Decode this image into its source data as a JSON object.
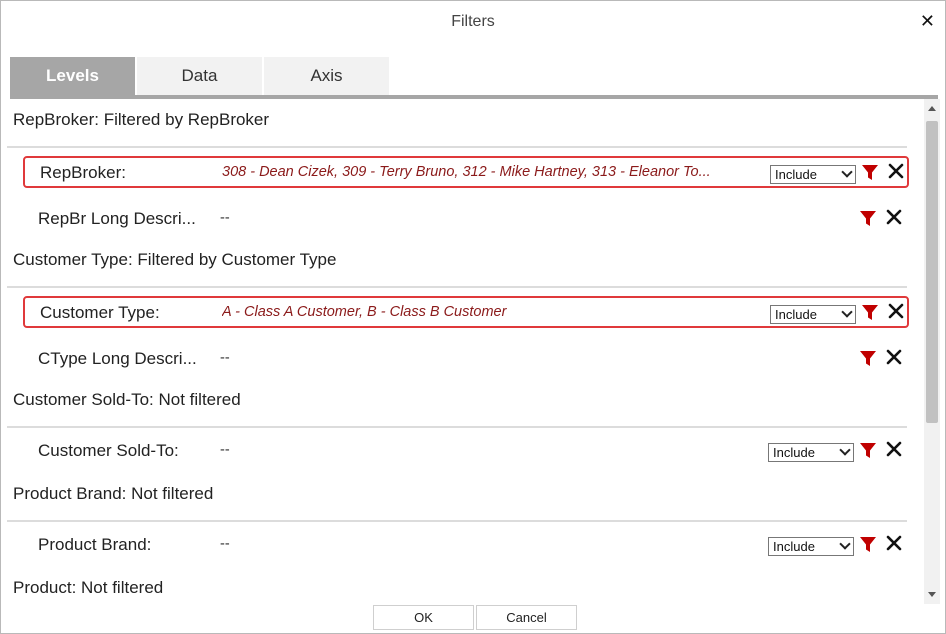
{
  "dialog": {
    "title": "Filters"
  },
  "tabs": [
    {
      "label": "Levels",
      "active": true
    },
    {
      "label": "Data",
      "active": false
    },
    {
      "label": "Axis",
      "active": false
    }
  ],
  "groups": [
    {
      "header": "RepBroker: Filtered by RepBroker",
      "rows": [
        {
          "label": "RepBroker:",
          "value": "308 - Dean Cizek, 309 - Terry Bruno, 312 - Mike Hartney, 313 - Eleanor To...",
          "select": "Include",
          "highlight": true
        },
        {
          "label": "RepBr Long Descri...",
          "value": "--",
          "select": "",
          "highlight": false
        }
      ]
    },
    {
      "header": "Customer Type: Filtered by Customer Type",
      "rows": [
        {
          "label": "Customer Type:",
          "value": "A - Class A Customer, B - Class B Customer",
          "select": "Include",
          "highlight": true
        },
        {
          "label": "CType Long Descri...",
          "value": "--",
          "select": "",
          "highlight": false
        }
      ]
    },
    {
      "header": "Customer Sold-To: Not filtered",
      "rows": [
        {
          "label": "Customer Sold-To:",
          "value": "--",
          "select": "Include",
          "highlight": false
        }
      ]
    },
    {
      "header": "Product Brand: Not filtered",
      "rows": [
        {
          "label": "Product Brand:",
          "value": "--",
          "select": "Include",
          "highlight": false
        }
      ]
    },
    {
      "header": "Product: Not filtered",
      "rows": []
    }
  ],
  "buttons": {
    "ok": "OK",
    "cancel": "Cancel"
  },
  "icons": {
    "filter": "filter-funnel-icon",
    "remove": "remove-x-icon",
    "close": "close-icon"
  },
  "colors": {
    "filtered_text": "#8b1a1a",
    "highlight_border": "#e0393b",
    "funnel": "#c00000",
    "active_tab": "#a6a6a6"
  }
}
